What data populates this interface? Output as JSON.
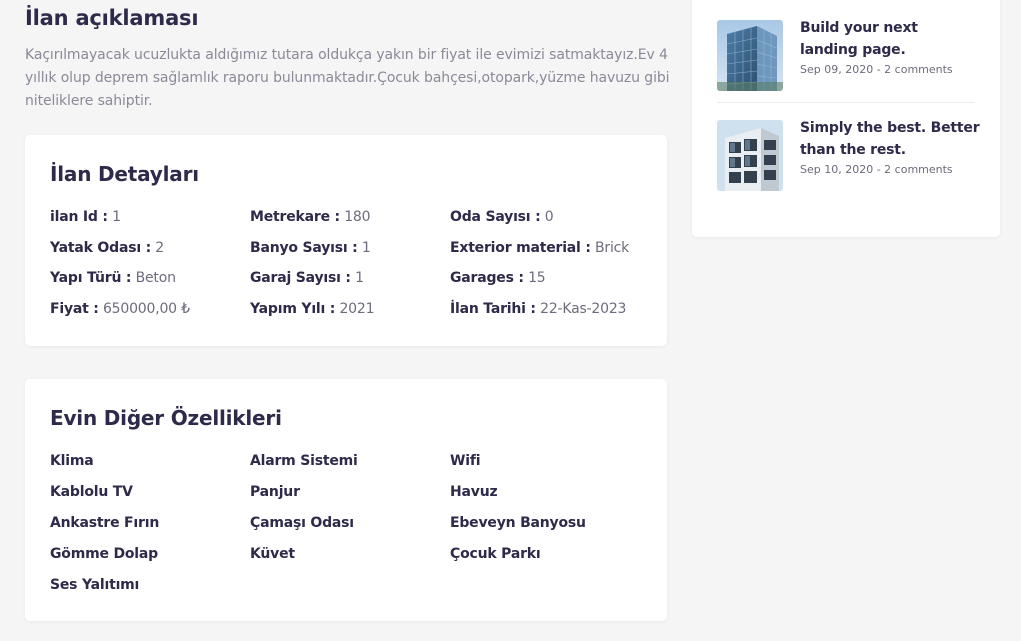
{
  "description": {
    "title": "İlan açıklaması",
    "text": "Kaçırılmayacak ucuzlukta aldığımız tutara oldukça yakın bir fiyat ile evimizi satmaktayız.Ev 4 yıllık olup deprem sağlamlık raporu bulunmaktadır.Çocuk bahçesi,otopark,yüzme havuzu gibi niteliklere sahiptir."
  },
  "details": {
    "title": "İlan Detayları",
    "items": [
      {
        "label": "ilan Id :",
        "value": "1"
      },
      {
        "label": "Metrekare :",
        "value": "180"
      },
      {
        "label": "Oda Sayısı :",
        "value": "0"
      },
      {
        "label": "Yatak Odası :",
        "value": "2"
      },
      {
        "label": "Banyo Sayısı :",
        "value": "1"
      },
      {
        "label": "Exterior material :",
        "value": "Brick"
      },
      {
        "label": "Yapı Türü :",
        "value": "Beton"
      },
      {
        "label": "Garaj Sayısı :",
        "value": "1"
      },
      {
        "label": "Garages :",
        "value": "15"
      },
      {
        "label": "Fiyat :",
        "value": "650000,00 ₺"
      },
      {
        "label": "Yapım Yılı :",
        "value": "2021"
      },
      {
        "label": "İlan Tarihi :",
        "value": "22-Kas-2023"
      }
    ]
  },
  "features": {
    "title": "Evin Diğer Özellikleri",
    "items": [
      "Klima",
      "Alarm Sistemi",
      "Wifi",
      "Kablolu TV",
      "Panjur",
      "Havuz",
      "Ankastre Fırın",
      "Çamaşı Odası",
      "Ebeveyn Banyosu",
      "Gömme Dolap",
      "Küvet",
      "Çocuk Parkı",
      "Ses Yalıtımı"
    ]
  },
  "posts": [
    {
      "title": "Build your next landing page.",
      "meta": "Sep 09, 2020 - 2 comments",
      "image": "glass-building-image"
    },
    {
      "title": "Simply the best. Better than the rest.",
      "meta": "Sep 10, 2020 - 2 comments",
      "image": "modern-building-image"
    }
  ],
  "colors": {
    "background": "#f5f5f6",
    "heading": "#2d2a4a",
    "muted_text": "#8a8a98",
    "card": "#ffffff"
  }
}
